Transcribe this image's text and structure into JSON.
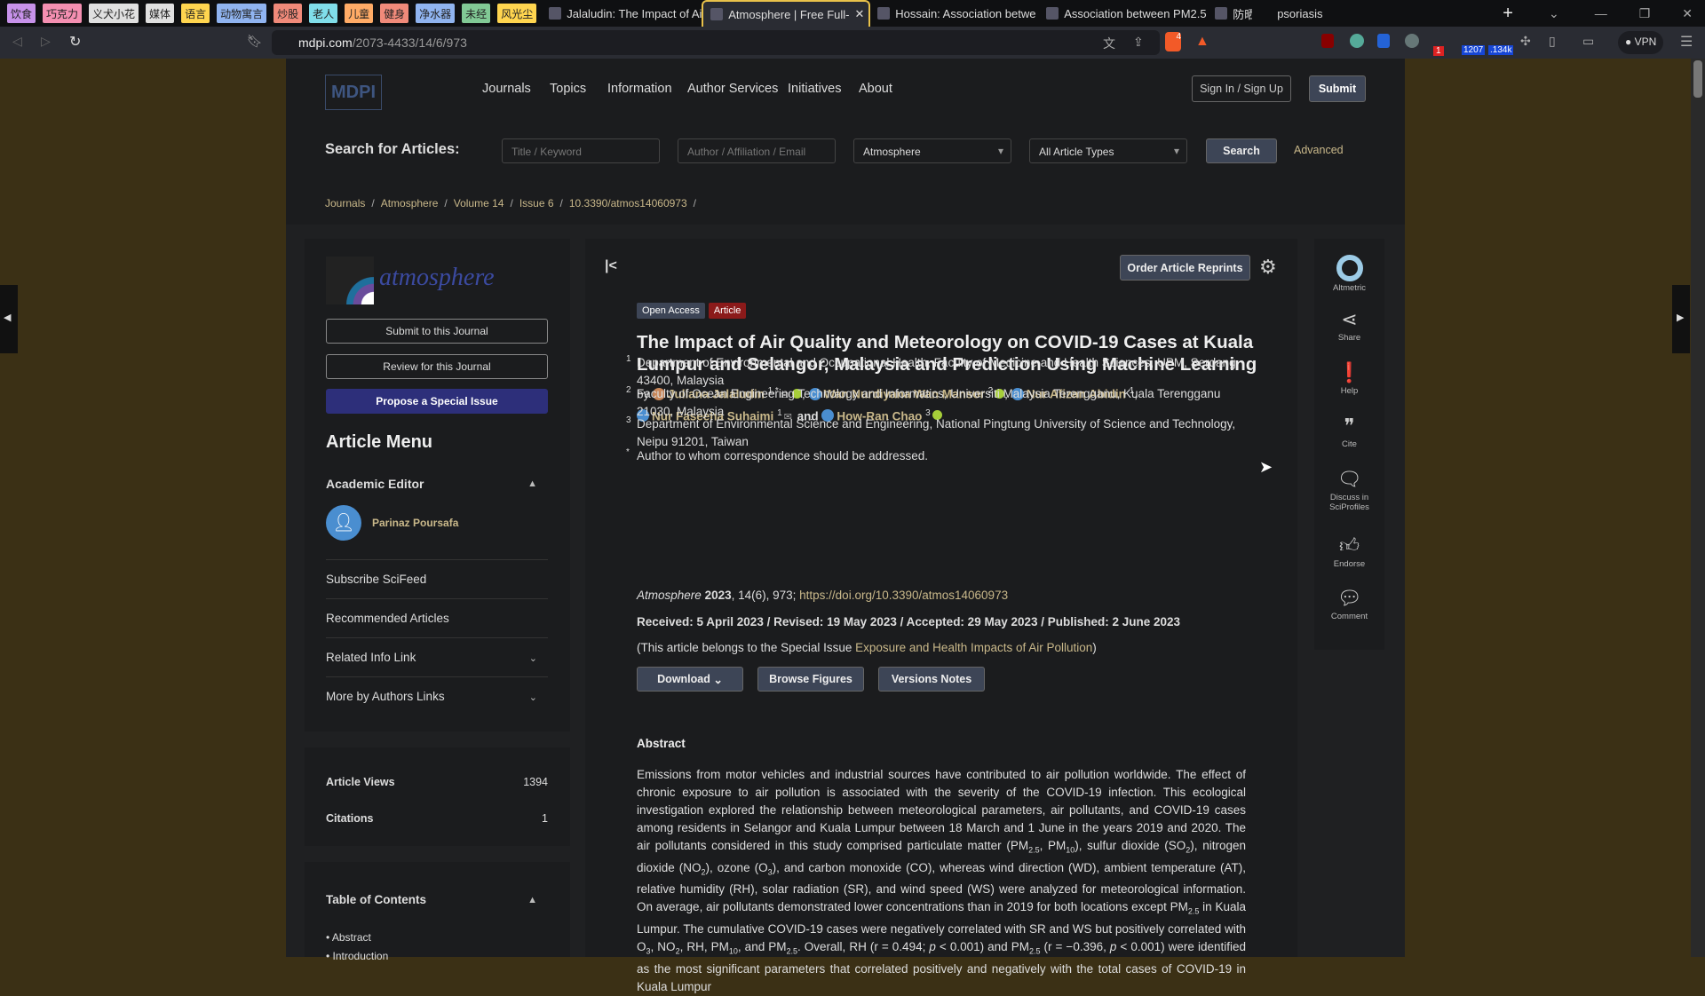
{
  "browser": {
    "bookmarks": [
      {
        "label": "饮食",
        "color": "#c792ea"
      },
      {
        "label": "巧克力",
        "color": "#f48fb1"
      },
      {
        "label": "义犬小花",
        "color": "#e0e0e0"
      },
      {
        "label": "媒体",
        "color": "#e0e0e0"
      },
      {
        "label": "语言",
        "color": "#ffd54f"
      },
      {
        "label": "动物寓言",
        "color": "#90b4f0"
      },
      {
        "label": "炒股",
        "color": "#f08a7a"
      },
      {
        "label": "老人",
        "color": "#80deea"
      },
      {
        "label": "儿童",
        "color": "#ffab66"
      },
      {
        "label": "健身",
        "color": "#f08a7a"
      },
      {
        "label": "净水器",
        "color": "#90b4f0"
      },
      {
        "label": "未经",
        "color": "#81c995"
      },
      {
        "label": "风光尘",
        "color": "#ffd54f"
      }
    ],
    "tabs": [
      {
        "title": "Jalaludin: The Impact of Air",
        "active": false
      },
      {
        "title": "Atmosphere | Free Full-",
        "active": true
      },
      {
        "title": "Hossain: Association betwe",
        "active": false
      },
      {
        "title": "Association between PM2.5",
        "active": false
      },
      {
        "title": "防晒",
        "active": false
      },
      {
        "title": "psoriasis",
        "active": false
      }
    ],
    "url_host": "mdpi.com",
    "url_path": "/2073-4433/14/6/973",
    "ext_badges": {
      "brave": "4",
      "rss": "1207",
      "ext2": ".134k",
      "ext1": "1"
    },
    "vpn": "VPN"
  },
  "header": {
    "logo": "MDPI",
    "nav": [
      "Journals",
      "Topics",
      "Information",
      "Author Services",
      "Initiatives",
      "About"
    ],
    "sign_in": "Sign In / Sign Up",
    "submit": "Submit",
    "search_label": "Search for Articles:",
    "title_placeholder": "Title / Keyword",
    "author_placeholder": "Author / Affiliation / Email",
    "journal_select": "Atmosphere",
    "type_select": "All Article Types",
    "search_btn": "Search",
    "advanced": "Advanced",
    "breadcrumb": [
      "Journals",
      "Atmosphere",
      "Volume 14",
      "Issue 6",
      "10.3390/atmos14060973"
    ]
  },
  "left": {
    "journal_name": "atmosphere",
    "submit": "Submit to this Journal",
    "review": "Review for this Journal",
    "propose": "Propose a Special Issue",
    "menu_title": "Article Menu",
    "academic_editor": "Academic Editor",
    "editor_name": "Parinaz Poursafa",
    "items": [
      "Subscribe SciFeed",
      "Recommended Articles",
      "Related Info Link",
      "More by Authors Links"
    ],
    "stats": [
      {
        "label": "Article Views",
        "value": "1394"
      },
      {
        "label": "Citations",
        "value": "1"
      }
    ],
    "toc_title": "Table of Contents",
    "toc": [
      "Abstract",
      "Introduction"
    ]
  },
  "article": {
    "order_reprints": "Order Article Reprints",
    "badge_open": "Open Access",
    "badge_type": "Article",
    "title": "The Impact of Air Quality and Meteorology on COVID-19 Cases at Kuala Lumpur and Selangor, Malaysia and Prediction Using Machine Learning",
    "by": "by",
    "and": "and",
    "authors": [
      {
        "name": "Juliana Jalaludin",
        "sup": "1,*"
      },
      {
        "name": "Wan Nurdiyana Wan Mansor",
        "sup": "2"
      },
      {
        "name": "Nur Afizan Abidin",
        "sup": "1"
      },
      {
        "name": "Nur Faseeha Suhaimi",
        "sup": "1"
      },
      {
        "name": "How-Ran Chao",
        "sup": "3"
      }
    ],
    "affiliations": [
      {
        "n": "1",
        "text": "Department of Environmental and Occupational Health, Faculty of Medicine and Health Sciences, UPM, Serdang 43400, Malaysia"
      },
      {
        "n": "2",
        "text": "Faculty of Ocean Engineering Technology and Informatics, Universiti Malaysia Terengganu, Kuala Terengganu 21030, Malaysia"
      },
      {
        "n": "3",
        "text": "Department of Environmental Science and Engineering, National Pingtung University of Science and Technology, Neipu 91201, Taiwan"
      },
      {
        "n": "*",
        "text": "Author to whom correspondence should be addressed."
      }
    ],
    "citation_journal": "Atmosphere",
    "citation_year": "2023",
    "citation_rest": ", 14(6), 973; ",
    "doi": "https://doi.org/10.3390/atmos14060973",
    "dates": "Received: 5 April 2023 / Revised: 19 May 2023 / Accepted: 29 May 2023 / Published: 2 June 2023",
    "special_prefix": "(This article belongs to the Special Issue ",
    "special_issue": "Exposure and Health Impacts of Air Pollution",
    "special_suffix": ")",
    "download": "Download",
    "browse_figures": "Browse Figures",
    "versions": "Versions Notes",
    "abstract_title": "Abstract",
    "abstract": [
      [
        "Emissions from motor vehicles and industrial sources have contributed to air pollution worldwide. The effect of chronic exposure to air pollution is associated with the severity of the COVID-19 infection. This ecological investigation explored the relationship between meteorological parameters, air pollutants, and COVID-19 cases among residents in Selangor and Kuala Lumpur between 18 March and 1 June in the years 2019 and 2020. The air pollutants considered in this study comprised particulate matter (PM",
        ""
      ],
      [
        "2.5",
        "s"
      ],
      [
        ", PM",
        ""
      ],
      [
        "10",
        "s"
      ],
      [
        "), sulfur dioxide (SO",
        ""
      ],
      [
        "2",
        "s"
      ],
      [
        "), nitrogen dioxide (NO",
        ""
      ],
      [
        "2",
        "s"
      ],
      [
        "), ozone (O",
        ""
      ],
      [
        "3",
        "s"
      ],
      [
        "), and carbon monoxide (CO), whereas wind direction (WD), ambient temperature (AT), relative humidity (RH), solar radiation (SR), and wind speed (WS) were analyzed for meteorological information. On average, air pollutants demonstrated lower concentrations than in 2019 for both locations except PM",
        ""
      ],
      [
        "2.5",
        "s"
      ],
      [
        " in Kuala Lumpur. The cumulative COVID-19 cases were negatively correlated with SR and WS but positively correlated with O",
        ""
      ],
      [
        "3",
        "s"
      ],
      [
        ", NO",
        ""
      ],
      [
        "2",
        "s"
      ],
      [
        ", RH, PM",
        ""
      ],
      [
        "10",
        "s"
      ],
      [
        ", and PM",
        ""
      ],
      [
        "2.5",
        "s"
      ],
      [
        ". Overall, RH (r = 0.494; ",
        ""
      ],
      [
        "p",
        "i"
      ],
      [
        " < 0.001) and PM",
        ""
      ],
      [
        "2.5",
        "s"
      ],
      [
        " (r = −0.396, ",
        ""
      ],
      [
        "p",
        "i"
      ],
      [
        " < 0.001) were identified as the most significant parameters that correlated positively and negatively with the total cases of COVID-19 in Kuala Lumpur",
        ""
      ]
    ]
  },
  "right_sidebar": [
    {
      "label": "Altmetric",
      "icon": "altmetric-icon"
    },
    {
      "label": "Share",
      "icon": "share-icon"
    },
    {
      "label": "Help",
      "icon": "help-icon"
    },
    {
      "label": "Cite",
      "icon": "quote-icon"
    },
    {
      "label": "Discuss in SciProfiles",
      "icon": "discuss-icon"
    },
    {
      "label": "Endorse",
      "icon": "thumbs-up-icon"
    },
    {
      "label": "Comment",
      "icon": "comment-icon"
    }
  ]
}
